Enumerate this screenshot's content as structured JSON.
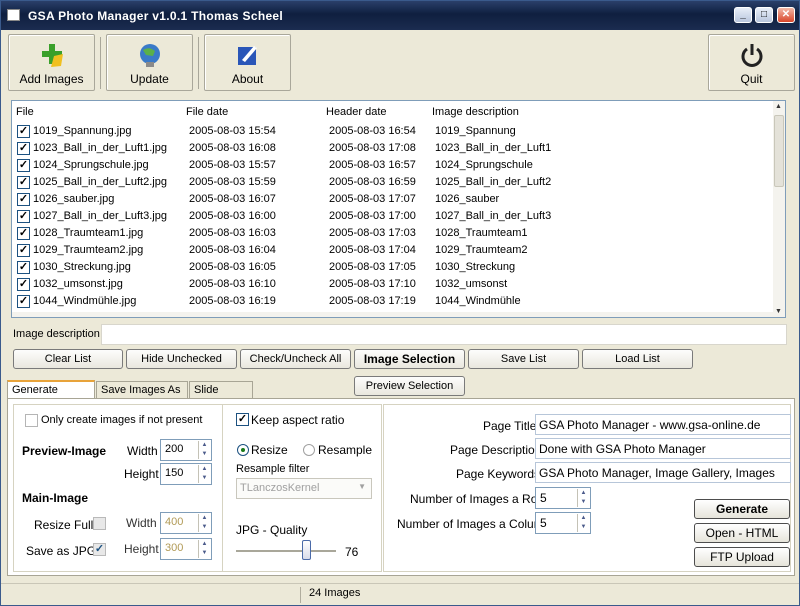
{
  "window": {
    "title": "GSA Photo Manager v1.0.1  Thomas Scheel"
  },
  "toolbar": {
    "add_images": "Add Images",
    "update": "Update",
    "about": "About",
    "quit": "Quit"
  },
  "list": {
    "columns": [
      "File",
      "File date",
      "Header date",
      "Image description"
    ],
    "rows": [
      [
        "1019_Spannung.jpg",
        "2005-08-03 15:54",
        "2005-08-03 16:54",
        "1019_Spannung"
      ],
      [
        "1023_Ball_in_der_Luft1.jpg",
        "2005-08-03 16:08",
        "2005-08-03 17:08",
        "1023_Ball_in_der_Luft1"
      ],
      [
        "1024_Sprungschule.jpg",
        "2005-08-03 15:57",
        "2005-08-03 16:57",
        "1024_Sprungschule"
      ],
      [
        "1025_Ball_in_der_Luft2.jpg",
        "2005-08-03 15:59",
        "2005-08-03 16:59",
        "1025_Ball_in_der_Luft2"
      ],
      [
        "1026_sauber.jpg",
        "2005-08-03 16:07",
        "2005-08-03 17:07",
        "1026_sauber"
      ],
      [
        "1027_Ball_in_der_Luft3.jpg",
        "2005-08-03 16:00",
        "2005-08-03 17:00",
        "1027_Ball_in_der_Luft3"
      ],
      [
        "1028_Traumteam1.jpg",
        "2005-08-03 16:03",
        "2005-08-03 17:03",
        "1028_Traumteam1"
      ],
      [
        "1029_Traumteam2.jpg",
        "2005-08-03 16:04",
        "2005-08-03 17:04",
        "1029_Traumteam2"
      ],
      [
        "1030_Streckung.jpg",
        "2005-08-03 16:05",
        "2005-08-03 17:05",
        "1030_Streckung"
      ],
      [
        "1032_umsonst.jpg",
        "2005-08-03 16:10",
        "2005-08-03 17:10",
        "1032_umsonst"
      ],
      [
        "1044_Windmühle.jpg",
        "2005-08-03 16:19",
        "2005-08-03 17:19",
        "1044_Windmühle"
      ]
    ]
  },
  "description": {
    "label": "Image description",
    "value": ""
  },
  "actions": {
    "clear_list": "Clear List",
    "hide_unchecked": "Hide Unchecked",
    "check_uncheck_all": "Check/Uncheck All",
    "image_selection": "Image Selection",
    "save_list": "Save List",
    "load_list": "Load List"
  },
  "tabs": [
    "Generate HTML",
    "Save Images  As",
    "Slide Show"
  ],
  "preview_selection": "Preview Selection",
  "options": {
    "only_create_label": "Only create images if not present",
    "preview_image_heading": "Preview-Image",
    "main_image_heading": "Main-Image",
    "width_label": "Width",
    "height_label": "Height",
    "preview_width": "200",
    "preview_height": "150",
    "resize_full_label": "Resize Fulll",
    "save_as_jpg_label": "Save as JPG",
    "main_width": "400",
    "main_height": "300",
    "keep_aspect_label": "Keep aspect ratio",
    "resize_label": "Resize",
    "resample_label": "Resample",
    "resample_filter_label": "Resample filter",
    "resample_filter_value": "TLanczosKernel",
    "jpg_quality_label": "JPG - Quality",
    "jpg_quality_value": "76",
    "jpg_quality_fraction": 0.76
  },
  "page": {
    "title_label": "Page Title",
    "title_value": "GSA Photo Manager - www.gsa-online.de",
    "description_label": "Page Description",
    "description_value": "Done with GSA Photo Manager",
    "keywords_label": "Page Keywords",
    "keywords_value": "GSA Photo Manager, Image Gallery, Images",
    "images_row_label": "Number of Images a Row",
    "images_row_value": "5",
    "images_col_label": "Number of Images a Column",
    "images_col_value": "5"
  },
  "buttons": {
    "generate": "Generate",
    "open_html": "Open - HTML",
    "ftp_upload": "FTP Upload"
  },
  "status": {
    "count": "24 Images"
  },
  "colors": {
    "title_bar": "#1b2c50",
    "tab_highlight": "#e8a33a"
  }
}
